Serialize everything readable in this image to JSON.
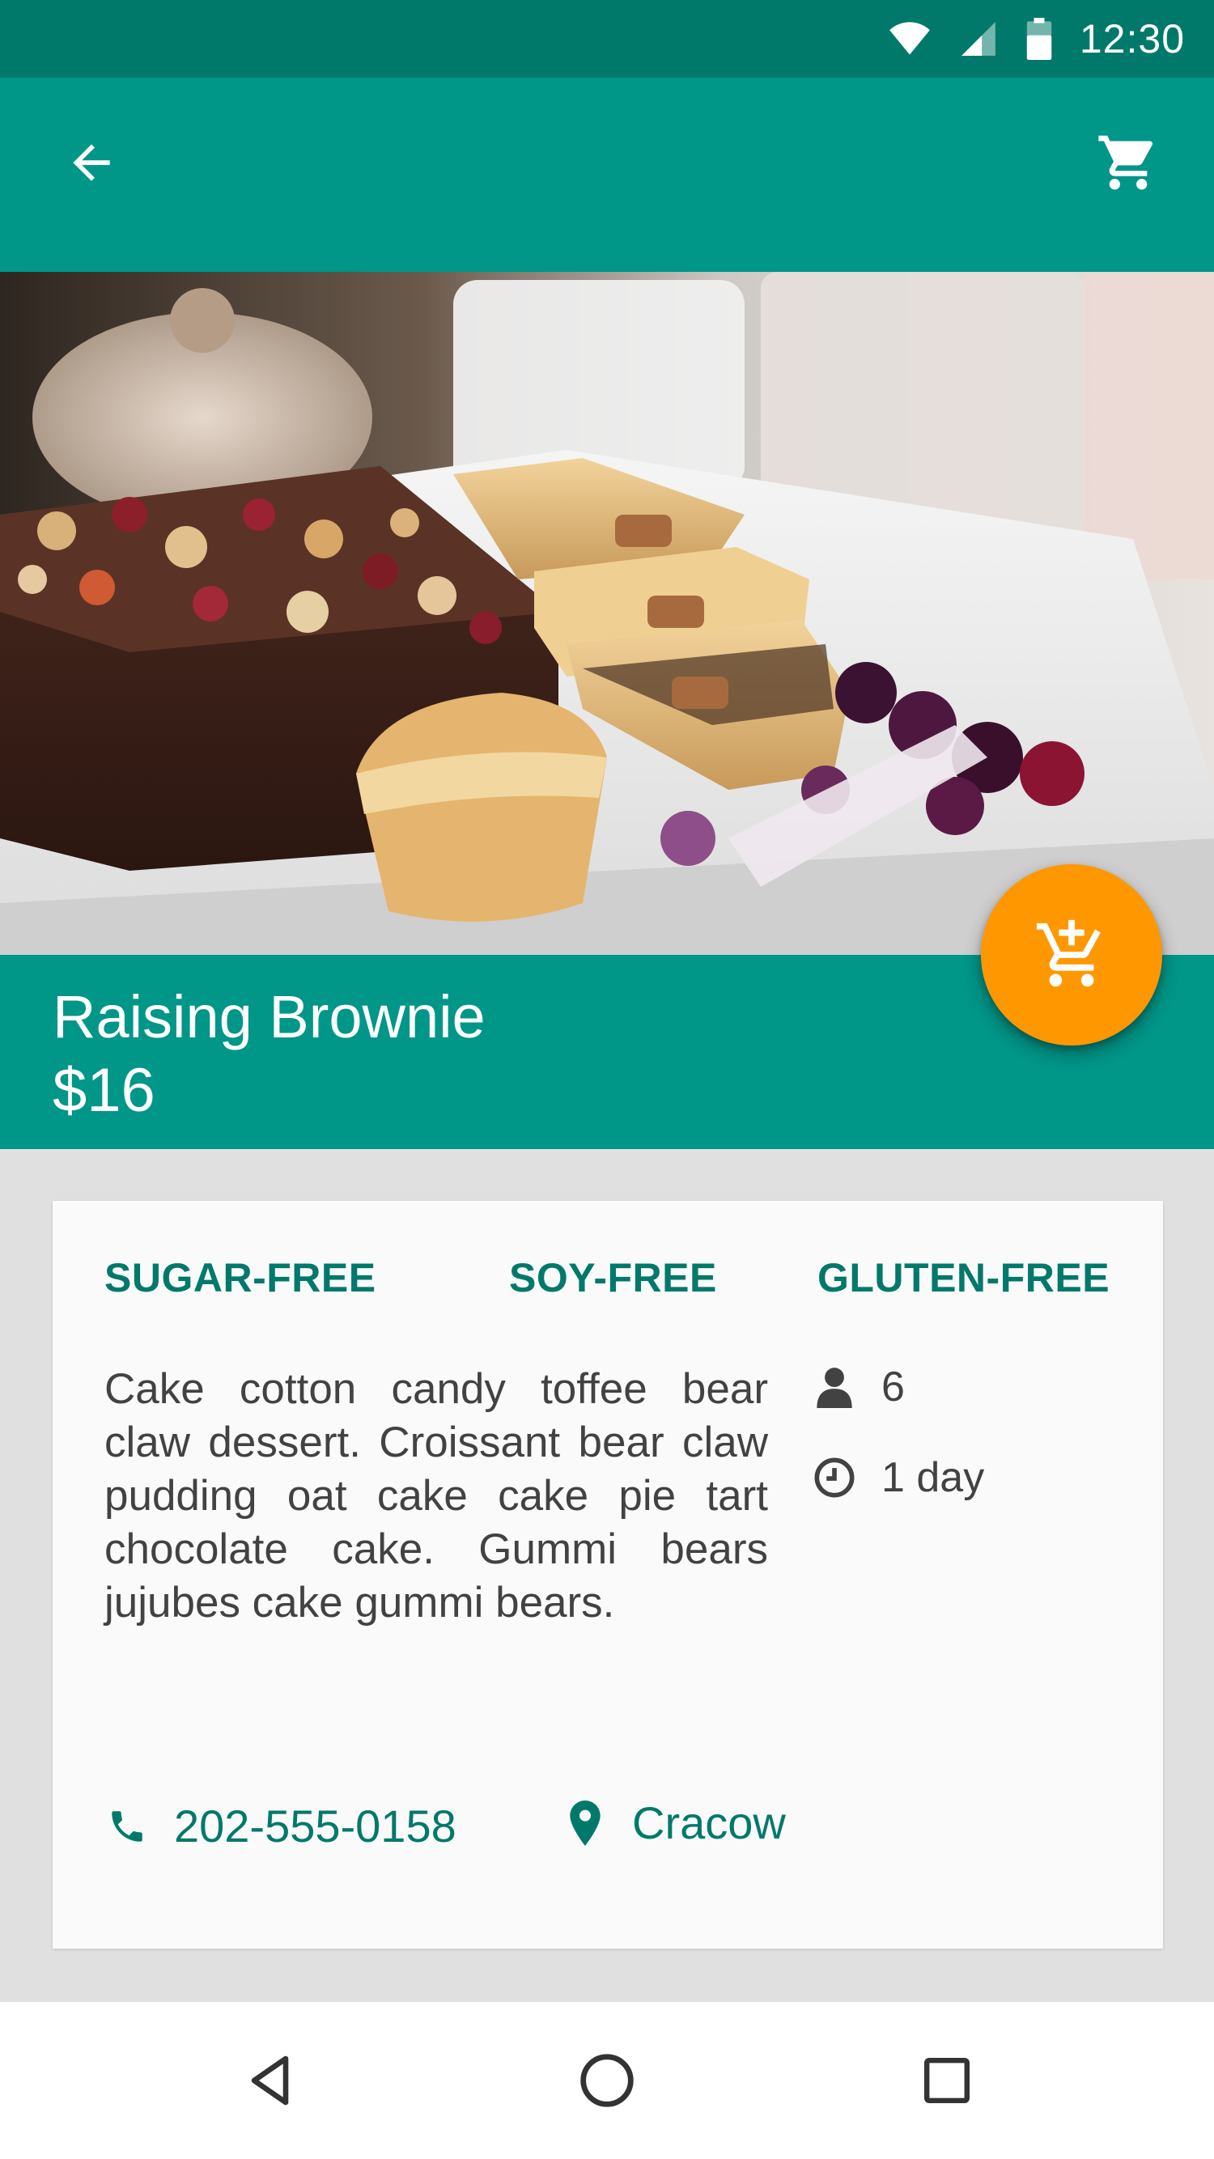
{
  "status_bar": {
    "time": "12:30"
  },
  "app_bar": {
    "back_icon": "arrow-back-icon",
    "cart_icon": "shopping-cart-icon"
  },
  "hero": {
    "image": "brownie-and-pie-on-white-plate"
  },
  "product": {
    "name": "Raising Brownie",
    "price": "$16"
  },
  "fab": {
    "icon": "add-shopping-cart-icon",
    "color": "#ff9800"
  },
  "tags": [
    "SUGAR-FREE",
    "SOY-FREE",
    "GLUTEN-FREE"
  ],
  "description": "Cake cotton candy toffee bear claw dessert. Croissant bear claw pudding oat cake cake pie tart chocolate cake. Gummi bears jujubes cake gummi bears.",
  "meta": {
    "servings": "6",
    "time": "1 day"
  },
  "contact": {
    "phone": "202-555-0158",
    "location": "Cracow"
  },
  "colors": {
    "primary": "#009688",
    "primary_dark": "#00796b",
    "accent": "#ff9800"
  }
}
